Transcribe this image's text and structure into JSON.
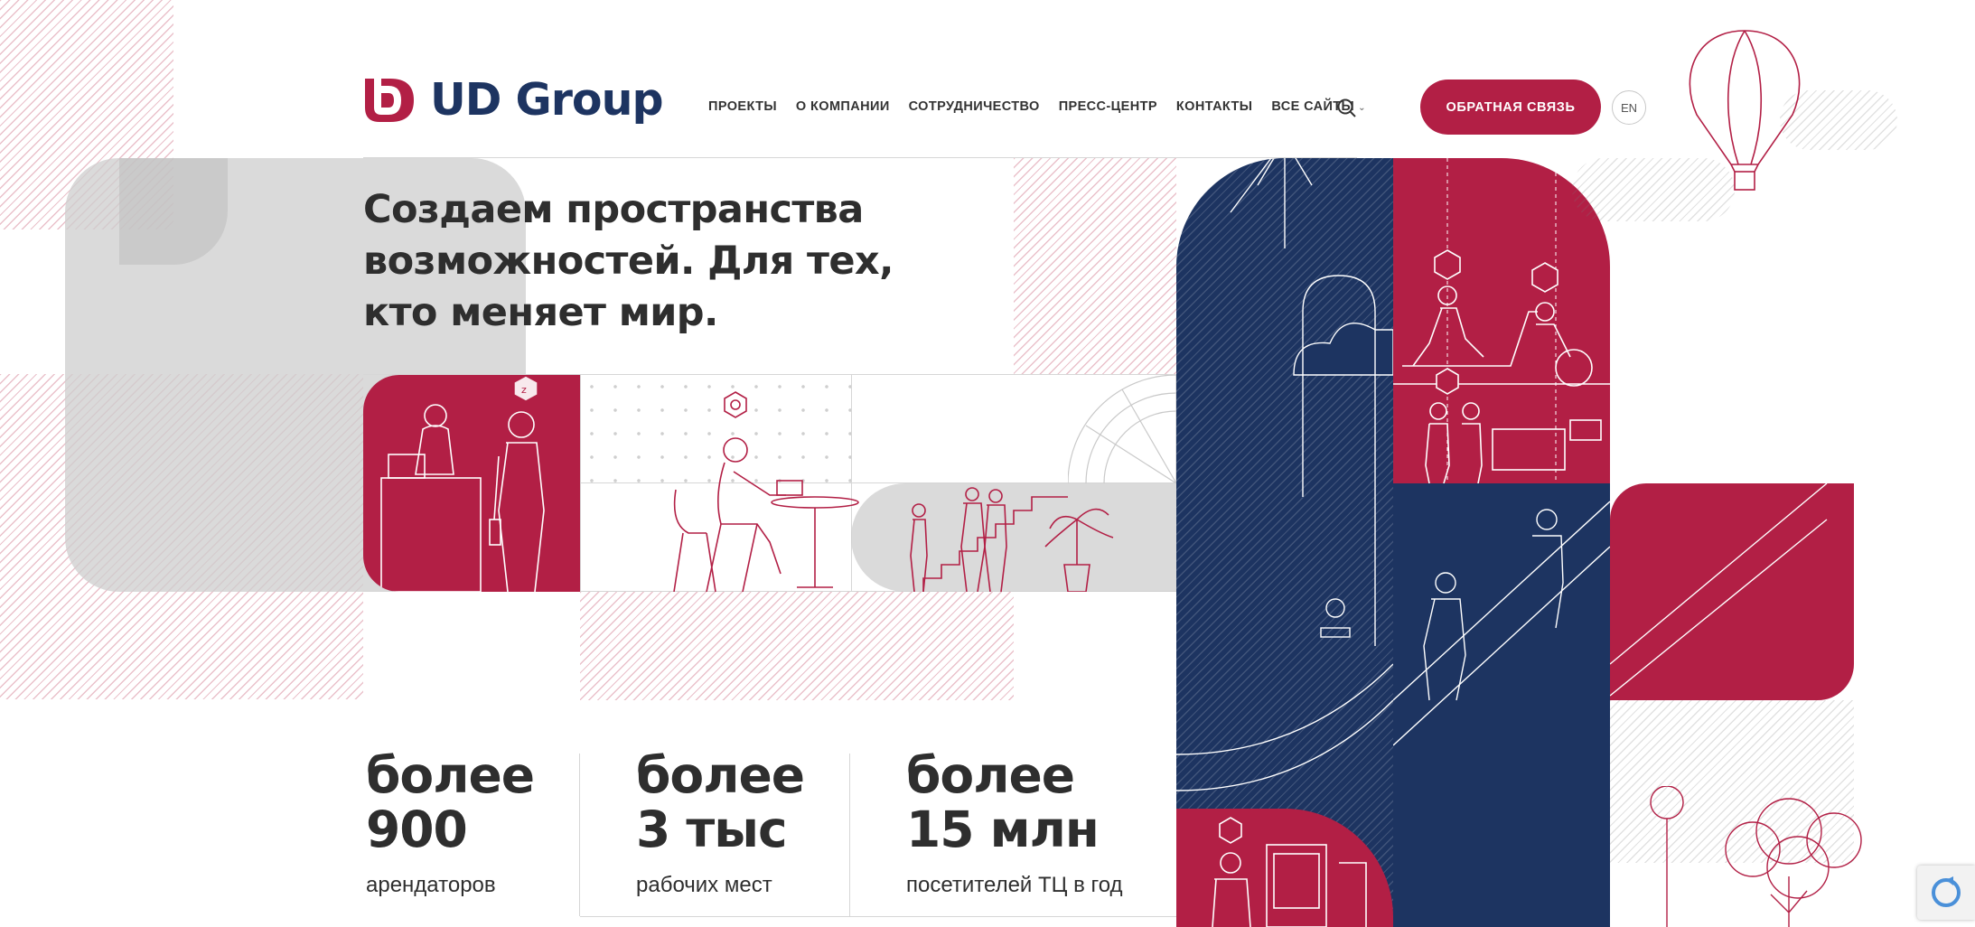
{
  "header": {
    "logo_text": "UD Group",
    "nav": [
      {
        "label": "ПРОЕКТЫ"
      },
      {
        "label": "О КОМПАНИИ"
      },
      {
        "label": "СОТРУДНИЧЕСТВО"
      },
      {
        "label": "ПРЕСС-ЦЕНТР"
      },
      {
        "label": "КОНТАКТЫ"
      },
      {
        "label": "ВСЕ САЙТЫ",
        "dropdown": true
      }
    ],
    "search_icon": "search-icon",
    "cta_label": "ОБРАТНАЯ СВЯЗЬ",
    "lang_label": "EN"
  },
  "hero": {
    "title_lines": [
      "Создаем пространства",
      "возможностей. Для тех,",
      "кто меняет мир."
    ]
  },
  "stats": [
    {
      "line1": "более",
      "line2": "900",
      "caption": "арендаторов"
    },
    {
      "line1": "более",
      "line2": "3 тыс",
      "caption": "рабочих мест"
    },
    {
      "line1": "более",
      "line2": "15 млн",
      "caption": "посетителей ТЦ в год"
    }
  ],
  "colors": {
    "brand_red": "#b21f45",
    "brand_navy": "#1d3461",
    "grey_block": "#d6d6d6"
  },
  "icons": [
    "heart-icon",
    "gift-icon",
    "ruble-icon",
    "tools-icon",
    "chat-icon",
    "sleep-icon",
    "briefcase-icon",
    "ring-icon",
    "book-icon",
    "basket-icon",
    "people-icon",
    "smile-icon"
  ]
}
